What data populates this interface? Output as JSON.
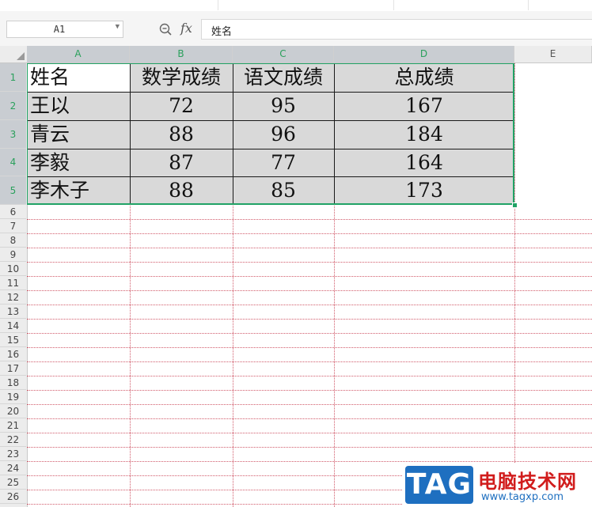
{
  "formula_bar": {
    "cell_ref": "A1",
    "fx_label": "fx",
    "formula_value": "姓名"
  },
  "columns": [
    "A",
    "B",
    "C",
    "D",
    "E"
  ],
  "rows": [
    "1",
    "2",
    "3",
    "4",
    "5",
    "6",
    "7",
    "8",
    "9",
    "10",
    "11",
    "12",
    "13",
    "14",
    "15",
    "16",
    "17",
    "18",
    "19",
    "20",
    "21",
    "22",
    "23",
    "24",
    "25",
    "26"
  ],
  "table": {
    "headers": [
      "姓名",
      "数学成绩",
      "语文成绩",
      "总成绩"
    ],
    "rows": [
      [
        "王以",
        "72",
        "95",
        "167"
      ],
      [
        "青云",
        "88",
        "96",
        "184"
      ],
      [
        "李毅",
        "87",
        "77",
        "164"
      ],
      [
        "李木子",
        "88",
        "85",
        "173"
      ]
    ]
  },
  "selection": {
    "range": "A1:D5",
    "color": "#21a366"
  },
  "colors": {
    "grid_line": "#d15b6b",
    "table_fill": "#d9d9d9",
    "header_bg": "#ececec"
  },
  "watermark": {
    "logo_text": "TAG",
    "site_name": "电脑技术网",
    "url": "www.tagxp.com"
  }
}
